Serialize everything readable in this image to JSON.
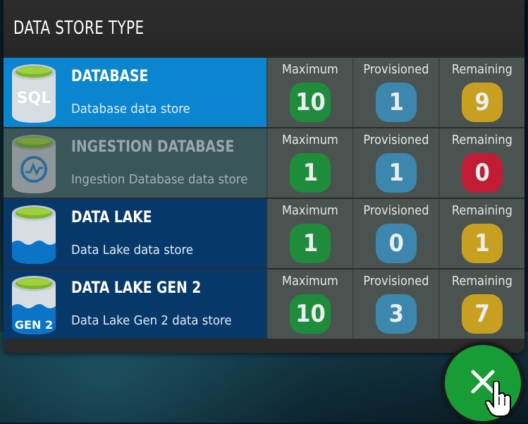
{
  "header": {
    "title": "DATA STORE TYPE"
  },
  "column_labels": {
    "maximum": "Maximum",
    "provisioned": "Provisioned",
    "remaining": "Remaining"
  },
  "rows": [
    {
      "name": "DATABASE",
      "description": "Database data store",
      "icon": "sql-database-icon",
      "icon_text": "SQL",
      "background": "#0a86d0",
      "maximum": "10",
      "provisioned": "1",
      "remaining": "9",
      "remaining_color": "gold"
    },
    {
      "name": "INGESTION DATABASE",
      "description": "Ingestion Database data store",
      "icon": "ingestion-database-icon",
      "background": "#3a5658",
      "maximum": "1",
      "provisioned": "1",
      "remaining": "0",
      "remaining_color": "red"
    },
    {
      "name": "DATA LAKE",
      "description": "Data Lake data store",
      "icon": "data-lake-icon",
      "background": "#06386a",
      "maximum": "1",
      "provisioned": "0",
      "remaining": "1",
      "remaining_color": "gold"
    },
    {
      "name": "DATA LAKE GEN 2",
      "description": "Data Lake Gen 2 data store",
      "icon": "data-lake-gen2-icon",
      "icon_text": "GEN 2",
      "background": "#06386a",
      "maximum": "10",
      "provisioned": "3",
      "remaining": "7",
      "remaining_color": "gold"
    }
  ],
  "close_button": {
    "icon": "close-icon",
    "color": "#189d36"
  }
}
